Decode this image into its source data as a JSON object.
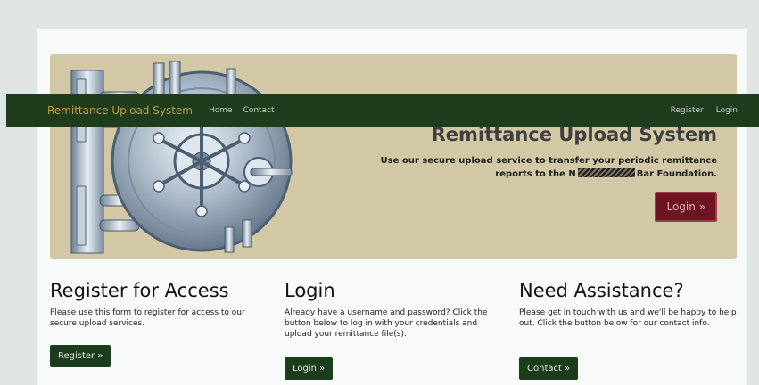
{
  "navbar": {
    "brand": "Remittance Upload System",
    "links": [
      "Home",
      "Contact"
    ],
    "right_links": [
      "Register",
      "Login"
    ]
  },
  "hero": {
    "title": "Remittance Upload System",
    "desc_line1": "Use our secure upload service to transfer your periodic remittance",
    "desc_line2_start": "reports to the N",
    "desc_line2_end": "Bar Foundation.",
    "button": "Login »"
  },
  "columns": [
    {
      "title": "Register for Access",
      "text": "Please use this form to register for access to our secure upload services.",
      "button": "Register »"
    },
    {
      "title": "Login",
      "text": "Already have a username and password? Click the button below to log in with your credentials and upload your remittance file(s).",
      "button": "Login »"
    },
    {
      "title": "Need Assistance?",
      "text": "Please get in touch with us and we'll be happy to help out. Click the button below for our contact info.",
      "button": "Contact »"
    }
  ],
  "colors": {
    "navbar": "#1f3d1d",
    "brand": "#b8a052",
    "hero_bg": "#d2c8a6",
    "hero_button": "#6e1320",
    "green_button": "#1c3d1c"
  },
  "icons": {
    "hero_image": "vault-door-illustration"
  }
}
